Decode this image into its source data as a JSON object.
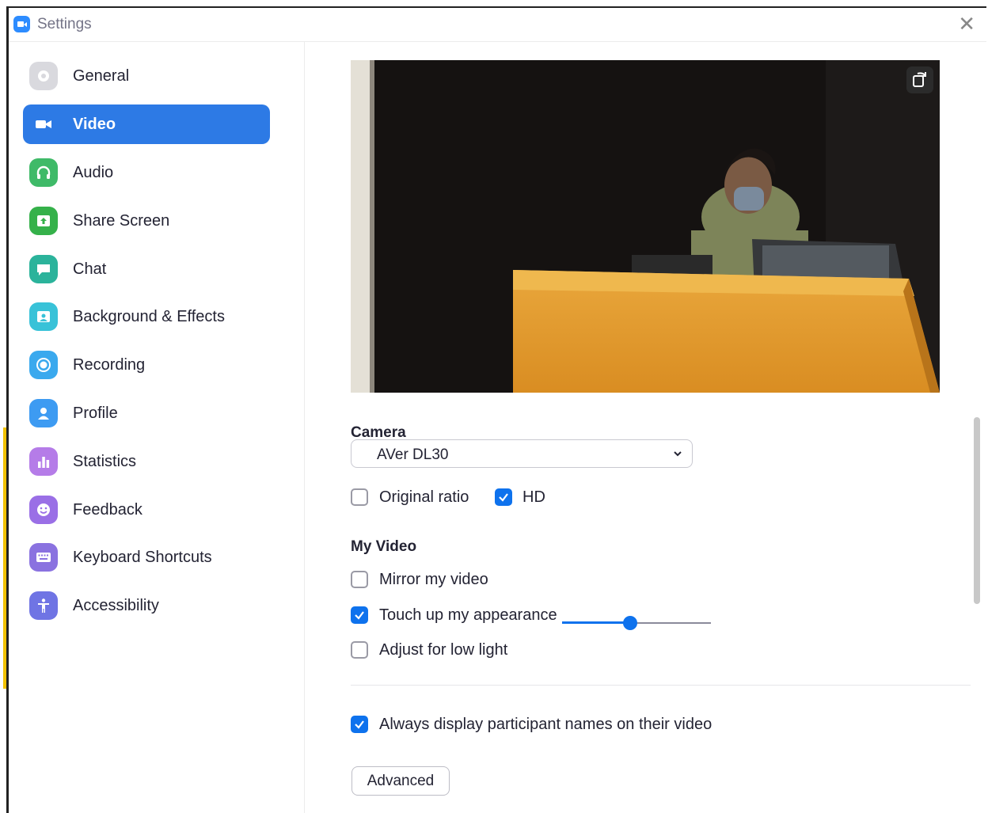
{
  "window": {
    "title": "Settings"
  },
  "colors": {
    "accent": "#2d7ae5",
    "checkbox": "#0e72ed"
  },
  "sidebar": {
    "items": [
      {
        "label": "General",
        "icon": "gear-icon",
        "color": "#d7d7db",
        "active": false
      },
      {
        "label": "Video",
        "icon": "video-camera-icon",
        "color": "#2d7ae5",
        "active": true
      },
      {
        "label": "Audio",
        "icon": "headphones-icon",
        "color": "#3cb371",
        "active": false
      },
      {
        "label": "Share Screen",
        "icon": "share-screen-icon",
        "color": "#35b14a",
        "active": false
      },
      {
        "label": "Chat",
        "icon": "chat-bubble-icon",
        "color": "#2bb39b",
        "active": false
      },
      {
        "label": "Background & Effects",
        "icon": "background-person-icon",
        "color": "#38c2d8",
        "active": false
      },
      {
        "label": "Recording",
        "icon": "record-icon",
        "color": "#3aa9ee",
        "active": false
      },
      {
        "label": "Profile",
        "icon": "profile-icon",
        "color": "#3d9bf2",
        "active": false
      },
      {
        "label": "Statistics",
        "icon": "bar-chart-icon",
        "color": "#b57ce8",
        "active": false
      },
      {
        "label": "Feedback",
        "icon": "smiley-icon",
        "color": "#9a6fe6",
        "active": false
      },
      {
        "label": "Keyboard Shortcuts",
        "icon": "keyboard-icon",
        "color": "#8a72e0",
        "active": false
      },
      {
        "label": "Accessibility",
        "icon": "accessibility-icon",
        "color": "#6f74e4",
        "active": false
      }
    ]
  },
  "video": {
    "camera_heading": "Camera",
    "camera_value": "AVer DL30",
    "original_ratio": {
      "label": "Original ratio",
      "checked": false
    },
    "hd": {
      "label": "HD",
      "checked": true
    },
    "my_video_heading": "My Video",
    "mirror": {
      "label": "Mirror my video",
      "checked": false
    },
    "touch_up": {
      "label": "Touch up my appearance",
      "checked": true,
      "level": 0.46
    },
    "low_light": {
      "label": "Adjust for low light",
      "checked": false
    },
    "always_names": {
      "label": "Always display participant names on their video",
      "checked": true
    },
    "advanced_label": "Advanced"
  }
}
